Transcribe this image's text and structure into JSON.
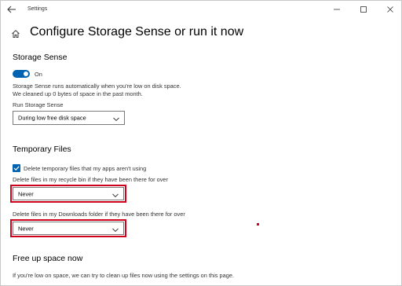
{
  "window": {
    "app_title": "Settings",
    "page_title": "Configure Storage Sense or run it now"
  },
  "storage_sense": {
    "heading": "Storage Sense",
    "toggle_state": "On",
    "description_line1": "Storage Sense runs automatically when you're low on disk space.",
    "description_line2": "We cleaned up 0 bytes of space in the past month.",
    "run_label": "Run Storage Sense",
    "run_value": "During low free disk space"
  },
  "temporary_files": {
    "heading": "Temporary Files",
    "delete_temp_label": "Delete temporary files that my apps aren't using",
    "delete_temp_checked": true,
    "recycle_bin_label": "Delete files in my recycle bin if they have been there for over",
    "recycle_bin_value": "Never",
    "downloads_label": "Delete files in my Downloads folder if they have been there for over",
    "downloads_value": "Never"
  },
  "free_up": {
    "heading": "Free up space now",
    "description": "If you're low on space, we can try to clean up files now using the settings on this page."
  },
  "colors": {
    "accent": "#0063b1",
    "highlight": "#d0021b"
  }
}
